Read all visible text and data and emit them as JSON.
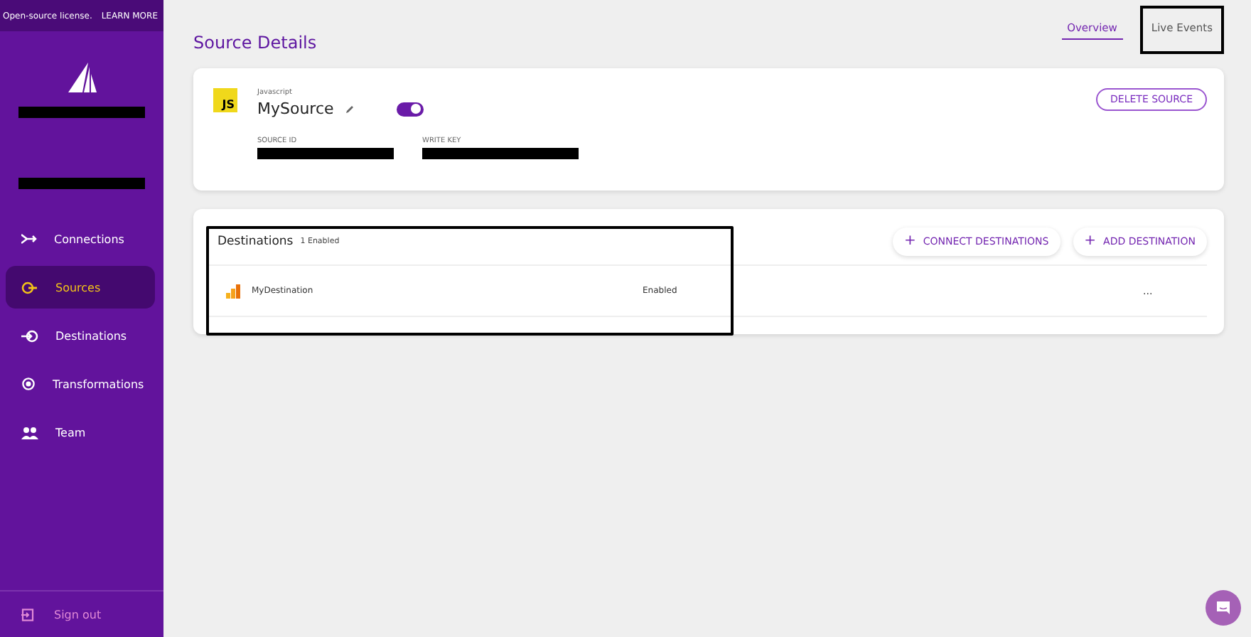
{
  "banner": {
    "text": "Open-source license.",
    "link": "LEARN MORE"
  },
  "sidebar": {
    "items": [
      {
        "label": "Connections",
        "kind": "connections",
        "selected": false
      },
      {
        "label": "Sources",
        "kind": "sources",
        "selected": true
      },
      {
        "label": "Destinations",
        "kind": "destinations",
        "selected": false
      },
      {
        "label": "Transformations",
        "kind": "transformations",
        "selected": false
      },
      {
        "label": "Team",
        "kind": "team",
        "selected": false
      }
    ],
    "sign_out": "Sign out"
  },
  "page": {
    "title": "Source Details",
    "tabs": [
      {
        "label": "Overview",
        "selected": true
      },
      {
        "label": "Live Events",
        "selected": false
      }
    ]
  },
  "source": {
    "badge": "JS",
    "type": "Javascript",
    "name": "MySource",
    "enabled": true,
    "delete_button": "DELETE SOURCE",
    "source_id_label": "SOURCE ID",
    "write_key_label": "WRITE KEY"
  },
  "destinations": {
    "title": "Destinations",
    "count": "1 Enabled",
    "buttons": [
      {
        "icon": "+",
        "label": "CONNECT DESTINATIONS"
      },
      {
        "icon": "+",
        "label": "ADD DESTINATION"
      }
    ],
    "rows": [
      {
        "name": "MyDestination",
        "status": "Enabled",
        "menu": "..."
      }
    ]
  }
}
